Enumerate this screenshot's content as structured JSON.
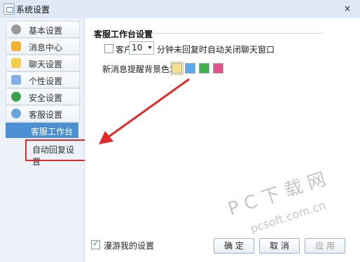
{
  "window": {
    "title": "系统设置",
    "close_glyph": "×"
  },
  "sidebar": {
    "items": [
      {
        "label": "基本设置",
        "icon": "gear-icon",
        "color": "#8c8c8c"
      },
      {
        "label": "消息中心",
        "icon": "envelope-icon",
        "color": "#f0a020"
      },
      {
        "label": "聊天设置",
        "icon": "chat-bubble-icon",
        "color": "#f0c040"
      },
      {
        "label": "个性设置",
        "icon": "personalize-icon",
        "color": "#6aa0e0"
      },
      {
        "label": "安全设置",
        "icon": "shield-icon",
        "color": "#3aa04a"
      },
      {
        "label": "客服设置",
        "icon": "support-globe-icon",
        "color": "#4a90d2"
      }
    ],
    "subitems": [
      {
        "label": "客服工作台",
        "active": true
      },
      {
        "label": "自动回复设置",
        "active": false
      }
    ]
  },
  "content": {
    "section_title": "客服工作台设置",
    "auto_close": {
      "prefix": "客户",
      "minutes": "10",
      "suffix": "分钟未回复时自动关闭聊天窗口",
      "checked": false
    },
    "bg_color_label": "新消息提醒背景色：",
    "bg_colors": [
      "#f7df8c",
      "#5aa9e8",
      "#3db24a",
      "#e8528a"
    ]
  },
  "bottom": {
    "roam_label": "漫游我的设置",
    "roam_checked": true,
    "ok_label": "确 定",
    "cancel_label": "取 消",
    "apply_label": "应 用"
  },
  "watermark": {
    "text": "P C 下 载 网",
    "url": "pcsoft.com.cn"
  },
  "accent_colors": {
    "active": "#4a90d2",
    "annotation": "#e12b2b"
  }
}
